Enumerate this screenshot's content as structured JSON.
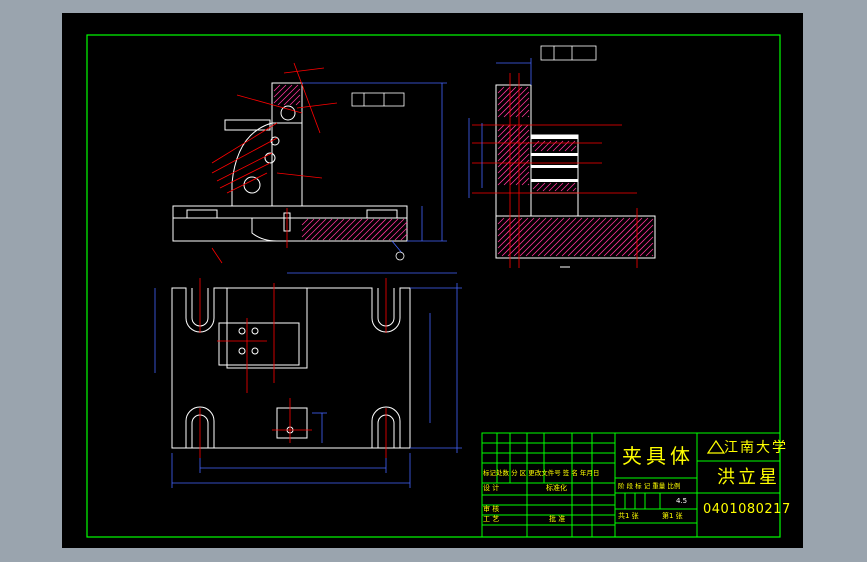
{
  "colors": {
    "background": "#9aa4ae",
    "viewport": "#000000",
    "border": "#00ff00",
    "outline": "#ffffff",
    "hatch": "#ff0000",
    "hatch_alt": "#ff3399",
    "center_line": "#ff0000",
    "dimension": "#4466ff",
    "title_text": "#ffff00",
    "leader": "#ff0000"
  },
  "title_block": {
    "part_name": "夹具体",
    "school": "江南大学",
    "designer_name": "洪立星",
    "student_id": "0401080217",
    "row_header": "标记处数 分 区 更改文件号 签 名 年月日",
    "design_label": "设 计",
    "standard_label": "标准化",
    "review_label": "审 核",
    "process_label": "工 艺",
    "approve_label": "批 准",
    "stage_header": "阶 段 标 记 重量 比例",
    "scale": "4.5",
    "sheet_total": "共1 张",
    "sheet_index": "第1 张"
  }
}
